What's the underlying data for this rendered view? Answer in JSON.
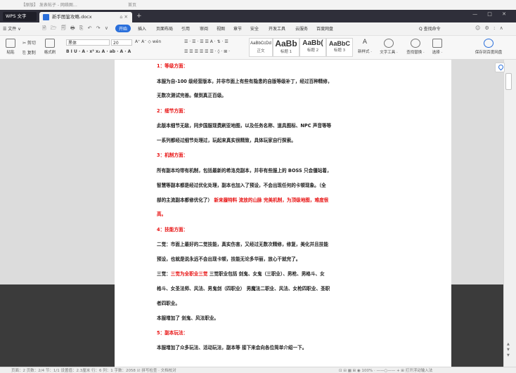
{
  "desktop_tabs": [
    "【原版】 发表帖子 - 网络图…",
    "首页"
  ],
  "titlebar": {
    "app_tab": "WPS 文字",
    "doc_title": "新手图鉴攻略.docx",
    "doc_tab_controls": "⌂ ✕",
    "new_tab": "+",
    "window_controls": "— □ ✕"
  },
  "menu": {
    "file": "☰ 文件 ∨",
    "quick_access": "🗎 🗁 🗐 🖶 ⎘ ↶ ↷ ∨",
    "items": [
      "开始",
      "插入",
      "页面布局",
      "引用",
      "审阅",
      "视图",
      "章节",
      "安全",
      "开发工具",
      "云服务",
      "百度网盘"
    ],
    "active": "开始",
    "search": "Q 查找命令",
    "right_icons": "☺ ⚙ : ∧"
  },
  "ribbon": {
    "paste": "粘贴",
    "cut": "✂ 剪切",
    "copy": "⎘ 复制",
    "format_painter": "格式刷",
    "font_name": "黑体",
    "font_size": "20",
    "font_row1": "A⁺ A⁻ ◇ wén",
    "font_row2": "B I U · A · x² x₂ A · ab · A · A",
    "para_row1": "☰ · ☰ · ☰ ☰ A · ⇅ · ☰",
    "para_row2": "☰ ☰ ☰ ☰ ☰ ☰ · ◊ · ⊞ ·",
    "styles": [
      {
        "sample": "AaBbCcDd",
        "name": "正文"
      },
      {
        "sample": "AaBb",
        "name": "标题 1"
      },
      {
        "sample": "AaBb(",
        "name": "标题 2"
      },
      {
        "sample": "AaBbC",
        "name": "标题 3"
      }
    ],
    "new_style": "新样式 ·",
    "text_tools": "文字工具 ·",
    "find_replace": "查找替换 ·",
    "select": "选择 ·",
    "baidu_save": "保存到百度网盘"
  },
  "document": {
    "lines": [
      {
        "text": "1：等级方面：",
        "style": "red"
      },
      {
        "text": "本服为自-100 级经营版本，并非市面上有些有隐患的自版等级补丁，经过百种精修，",
        "style": "black"
      },
      {
        "text": "无数次测试完善。做到真正百级。",
        "style": "black"
      },
      {
        "text": "2：细节方面：",
        "style": "red"
      },
      {
        "text": "此版本细节无敌，同步国服现费刷亚地图，以及任务名称、道具图标、NPC 声音等等",
        "style": "black"
      },
      {
        "text": "一系列都经过细节处理过，玩起来真实很精致，具体玩家自行探索。",
        "style": "black"
      },
      {
        "text": "3：机制方面：",
        "style": "red"
      },
      {
        "text": "所有副本均带有机制，包括最新的希洛克副本，并非有些服上的 BOSS 只会僵站着，",
        "style": "black"
      },
      {
        "text": "智慧等副本都是经过优化处理，副本也加入了预设，不会出现任何的卡顿现象。（全",
        "style": "black"
      },
      {
        "text": "部的主流副本都修优化了）",
        "style": "black",
        "red_tail": "新来履特料 流放的山脉 完美机制，为顶级地图，难度很"
      },
      {
        "text": "高。",
        "style": "red"
      },
      {
        "text": "4：技能方面：",
        "style": "red"
      },
      {
        "text": "二觉：市面上最好的二觉技能，真实伤害，又经过无数次精修，修复，美化并且技能",
        "style": "black"
      },
      {
        "text": "预设，也就是说永远不会出现卡顿，技能无论多华丽，放心干就完了。",
        "style": "black"
      },
      {
        "text": "三觉：",
        "style": "black",
        "red_mid": "三觉为全职业三觉",
        "after": " 三觉职业包括 剑鬼、女鬼（三职业）、男枪、男格斗、女"
      },
      {
        "text": "格斗、女圣法师、风法、男鬼剑（四职业） 男魔法二职业、风法、女枪四职业、圣职",
        "style": "black"
      },
      {
        "text": "者四职业。",
        "style": "black"
      },
      {
        "text": "本服增加了 剑鬼、风法职业。",
        "style": "black"
      },
      {
        "text": "5：副本玩法：",
        "style": "red"
      },
      {
        "text": "本服增加了众多玩法、活动玩法，副本等 接下来会向各位简单介绍一下。",
        "style": "black"
      }
    ]
  },
  "statusbar": {
    "left": "页面：2  页数：2/4  节：1/1  设置值：2.3厘米  行：6  列：1  字数：2058  ☑ 拼写检查 ·  文档校对",
    "right": "⊡ ⊟ ▦ ⊞ ◉ 100% · ——○—— +  ⊞ 打开浮动输入法"
  },
  "colors": {
    "accent": "#2a6fdb",
    "red_text": "#e81010",
    "titlebar": "#2f2f3a"
  }
}
